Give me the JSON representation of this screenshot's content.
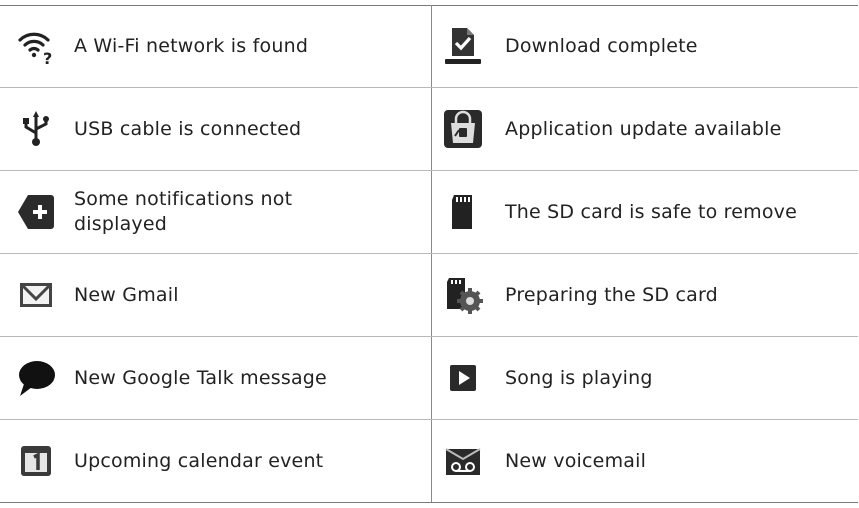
{
  "rows": [
    {
      "left": {
        "icon": "wifi-question-icon",
        "text": "A Wi-Fi network is found"
      },
      "right": {
        "icon": "download-complete-icon",
        "text": "Download complete"
      }
    },
    {
      "left": {
        "icon": "usb-icon",
        "text": "USB cable is connected"
      },
      "right": {
        "icon": "market-update-icon",
        "text": "Application update available"
      }
    },
    {
      "left": {
        "icon": "more-notifications-icon",
        "text": "Some notifications not displayed"
      },
      "right": {
        "icon": "sd-card-icon",
        "text": "The SD card is safe to remove"
      }
    },
    {
      "left": {
        "icon": "gmail-icon",
        "text": "New Gmail"
      },
      "right": {
        "icon": "sd-card-prepare-icon",
        "text": "Preparing the SD card"
      }
    },
    {
      "left": {
        "icon": "talk-bubble-icon",
        "text": "New Google Talk message"
      },
      "right": {
        "icon": "play-icon",
        "text": "Song is playing"
      }
    },
    {
      "left": {
        "icon": "calendar-icon",
        "text": "Upcoming calendar event"
      },
      "right": {
        "icon": "voicemail-icon",
        "text": "New voicemail"
      }
    }
  ]
}
